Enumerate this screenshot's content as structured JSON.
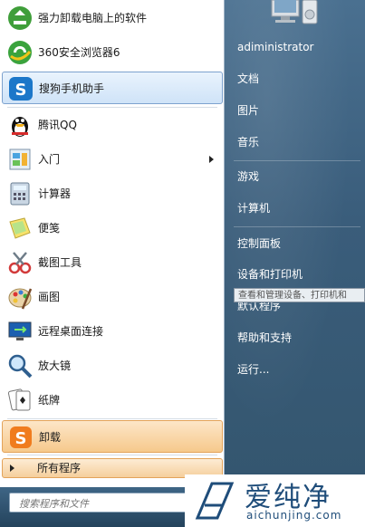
{
  "programs": [
    {
      "label": "强力卸载电脑上的软件",
      "icon": "recycle-uninstall-icon"
    },
    {
      "label": "360安全浏览器6",
      "icon": "360-browser-icon"
    },
    {
      "label": "搜狗手机助手",
      "icon": "sogou-phone-assistant-icon"
    },
    {
      "label": "腾讯QQ",
      "icon": "qq-penguin-icon"
    },
    {
      "label": "入门",
      "icon": "getting-started-icon"
    },
    {
      "label": "计算器",
      "icon": "calculator-icon"
    },
    {
      "label": "便笺",
      "icon": "sticky-notes-icon"
    },
    {
      "label": "截图工具",
      "icon": "snipping-tool-icon"
    },
    {
      "label": "画图",
      "icon": "paint-palette-icon"
    },
    {
      "label": "远程桌面连接",
      "icon": "remote-desktop-icon"
    },
    {
      "label": "放大镜",
      "icon": "magnifier-icon"
    },
    {
      "label": "纸牌",
      "icon": "solitaire-cards-icon"
    },
    {
      "label": "卸载",
      "icon": "sogou-uninstall-icon"
    }
  ],
  "all_programs": "所有程序",
  "search": {
    "placeholder": "搜索程序和文件"
  },
  "right_menu": {
    "user": "adiministrator",
    "documents": "文档",
    "pictures": "图片",
    "music": "音乐",
    "games": "游戏",
    "computer": "计算机",
    "control_panel": "控制面板",
    "devices_printers": "设备和打印机",
    "default_programs": "默认程序",
    "help_support": "帮助和支持",
    "run": "运行..."
  },
  "tooltip": "查看和管理设备、打印机和",
  "watermark": {
    "title": "爱纯净",
    "url": "aichunjing.com"
  },
  "colors": {
    "highlight_blue": "#cfe3f8",
    "highlight_orange": "#f6c98c",
    "right_panel": "#3a5d7b"
  }
}
